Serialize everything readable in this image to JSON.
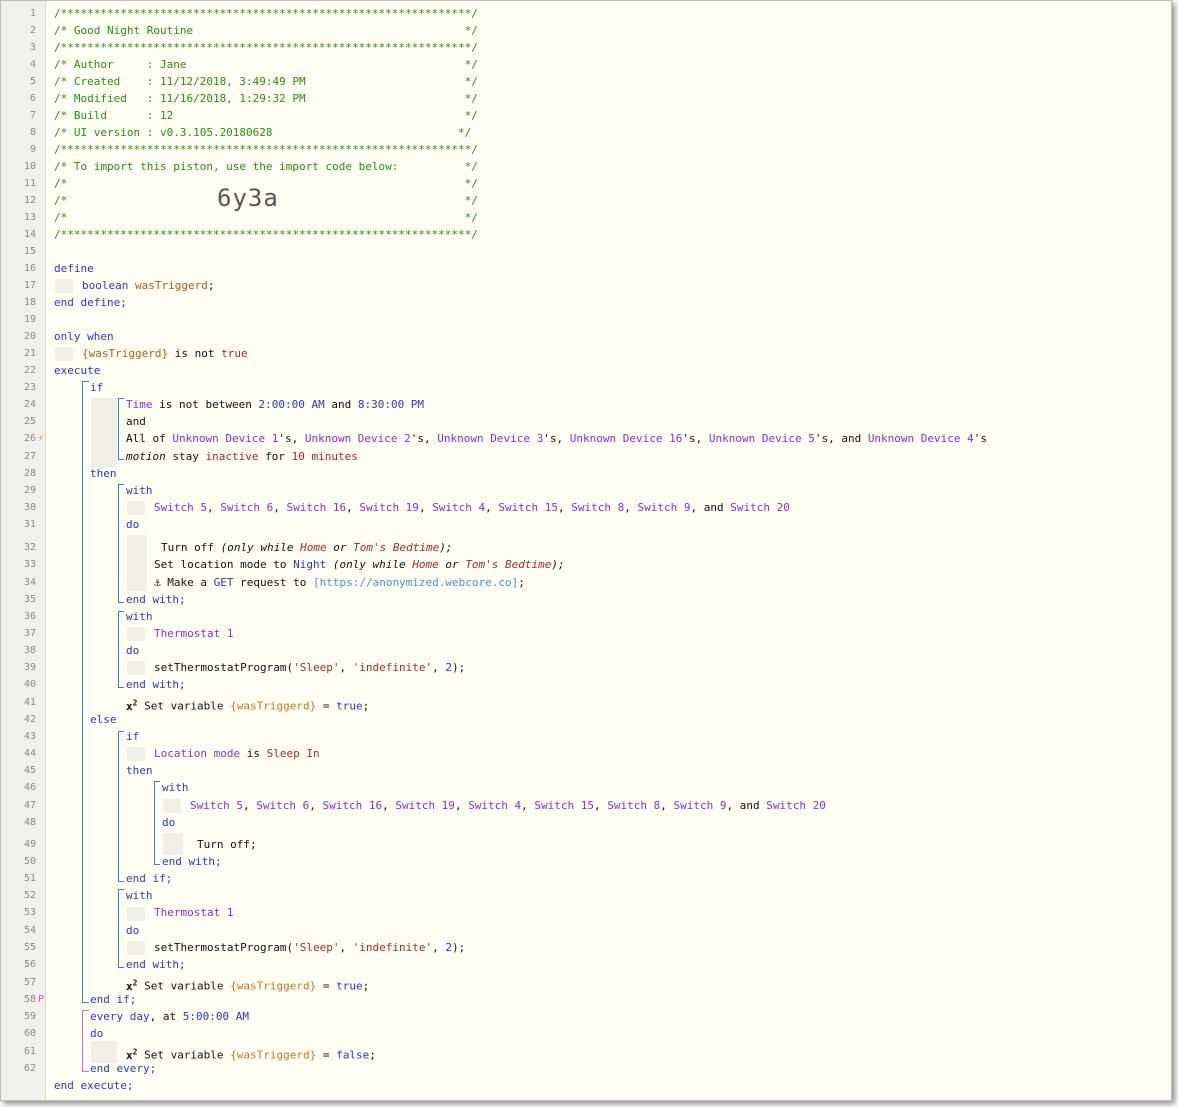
{
  "editor": {
    "line_numbers": [
      "1",
      "2",
      "3",
      "4",
      "5",
      "6",
      "7",
      "8",
      "9",
      "10",
      "11",
      "12",
      "13",
      "14",
      "15",
      "16",
      "17",
      "18",
      "19",
      "20",
      "21",
      "22",
      "23",
      "24",
      "25",
      "26",
      "27",
      "28",
      "29",
      "30",
      "31",
      "32",
      "33",
      "34",
      "35",
      "36",
      "37",
      "38",
      "39",
      "40",
      "41",
      "42",
      "43",
      "44",
      "45",
      "46",
      "47",
      "48",
      "49",
      "50",
      "51",
      "52",
      "53",
      "54",
      "55",
      "56",
      "57",
      "58",
      "59",
      "60",
      "61",
      "62"
    ],
    "gutter_icons": {
      "line26": "⚡",
      "line58": "P"
    }
  },
  "header": {
    "stars": "/**************************************************************/",
    "title": "/* Good Night Routine                                         */",
    "author": "/* Author     : Jane                                          */",
    "created": "/* Created    : 11/12/2018, 3:49:49 PM                        */",
    "modified": "/* Modified   : 11/16/2018, 1:29:32 PM                        */",
    "build": "/* Build      : 12                                            */",
    "ui_version": "/* UI version : v0.3.105.20180628                            */",
    "import_note": "/* To import this piston, use the import code below:          */",
    "blank_comment": "/*                                                            */",
    "import_code": "6y3a"
  },
  "code": {
    "define": "define",
    "boolean": "boolean",
    "var": "wasTriggerd",
    "end_define": "end define;",
    "only_when": "only when",
    "var_braced": "{wasTriggerd}",
    "is_not": "is not",
    "true": "true",
    "false": "false",
    "execute": "execute",
    "if": "if",
    "then": "then",
    "else": "else",
    "and": "and",
    "do": "do",
    "with": "with",
    "end_with": "end with;",
    "end_if": "end if;",
    "end_every": "end every;",
    "end_execute": "end execute;",
    "time": "Time",
    "is_not_between": "is not between",
    "t1": "2:00:00 AM",
    "t2": "8:30:00 PM",
    "all_of": "All of",
    "devices": [
      "Unknown Device 1",
      "Unknown Device 2",
      "Unknown Device 3",
      "Unknown Device 16",
      "Unknown Device 5",
      "Unknown Device 4"
    ],
    "motion": "motion",
    "stay": "stay",
    "inactive": "inactive",
    "for": "for",
    "ten_minutes": "10 minutes",
    "switches": [
      "Switch 5",
      "Switch 6",
      "Switch 16",
      "Switch 19",
      "Switch 4",
      "Switch 15",
      "Switch 8",
      "Switch 9",
      "Switch 20"
    ],
    "turn_off": "Turn off",
    "only_while": "(only while",
    "home": "Home",
    "or": "or",
    "toms_bedtime": "Tom's Bedtime",
    "set_location_mode": "Set location mode to",
    "night": "Night",
    "make_a": "Make a",
    "get": "GET",
    "request_to": "request to",
    "url": "[https://anonymized.webcore.co]",
    "thermostat": "Thermostat 1",
    "set_program": "setThermostatProgram(",
    "sleep_arg": "'Sleep'",
    "indef_arg": "'indefinite'",
    "num2": "2",
    "set_variable": "Set variable",
    "location_mode": "Location mode",
    "is": "is",
    "sleep_in": "Sleep In",
    "turn_off_plain": "Turn off;",
    "every": "every",
    "day": "day",
    "at": "at",
    "t3": "5:00:00 AM"
  }
}
